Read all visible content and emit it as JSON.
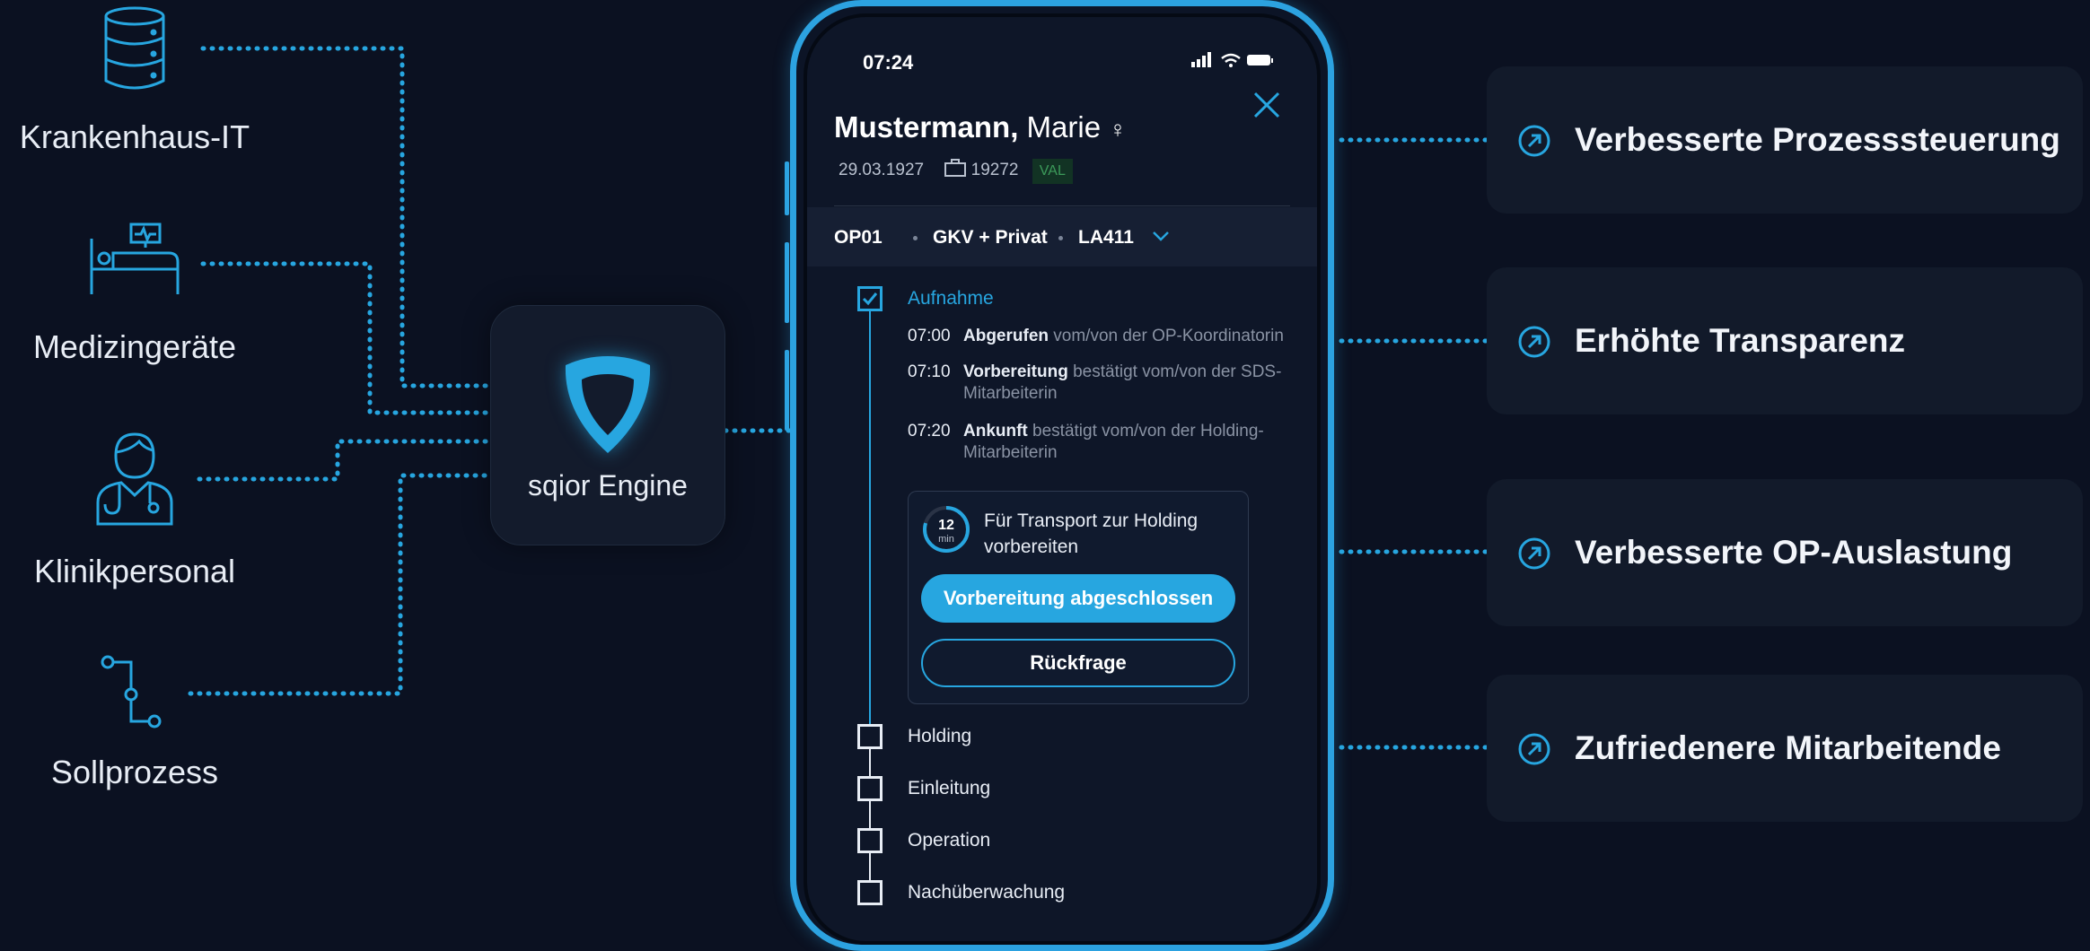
{
  "colors": {
    "accent": "#27a6e0",
    "background": "#0b1121",
    "card": "#121a2a"
  },
  "sources": [
    {
      "label": "Krankenhaus-IT",
      "icon": "database-icon"
    },
    {
      "label": "Medizingeräte",
      "icon": "hospital-bed-monitor-icon"
    },
    {
      "label": "Klinikpersonal",
      "icon": "doctor-stethoscope-icon"
    },
    {
      "label": "Sollprozess",
      "icon": "process-flow-icon"
    }
  ],
  "engine": {
    "label": "sqior Engine",
    "icon": "sqior-shield-icon"
  },
  "benefits": [
    {
      "label": "Verbesserte Prozesssteuerung",
      "icon": "arrow-up-right-circle-icon"
    },
    {
      "label": "Erhöhte Transparenz",
      "icon": "arrow-up-right-circle-icon"
    },
    {
      "label": "Verbesserte OP-Auslastung",
      "icon": "arrow-up-right-circle-icon"
    },
    {
      "label": "Zufriedenere Mitarbeitende",
      "icon": "arrow-up-right-circle-icon"
    }
  ],
  "phone": {
    "time": "07:24",
    "patient": {
      "last_name": "Mustermann,",
      "first_name": "Marie",
      "gender_symbol": "♀",
      "birthdate": "29.03.1927",
      "case_id": "19272",
      "badge": "VAL"
    },
    "tags": [
      "OP01",
      "GKV + Privat",
      "LA411"
    ],
    "steps": [
      {
        "label": "Aufnahme",
        "done": true
      },
      {
        "label": "Holding",
        "done": false
      },
      {
        "label": "Einleitung",
        "done": false
      },
      {
        "label": "Operation",
        "done": false
      },
      {
        "label": "Nachüberwachung",
        "done": false
      }
    ],
    "events": [
      {
        "time": "07:00",
        "action": "Abgerufen",
        "rest": "vom/von der OP-Koordinatorin",
        "cont": ""
      },
      {
        "time": "07:10",
        "action": "Vorbereitung",
        "rest": "bestätigt vom/von der SDS-",
        "cont": "Mitarbeiterin"
      },
      {
        "time": "07:20",
        "action": "Ankunft",
        "rest": "bestätigt vom/von der Holding-",
        "cont": "Mitarbeiterin"
      }
    ],
    "task": {
      "timer_value": "12",
      "timer_unit": "min",
      "title_line1": "Für Transport zur Holding",
      "title_line2": "vorbereiten",
      "primary_button": "Vorbereitung abgeschlossen",
      "secondary_button": "Rückfrage"
    }
  }
}
